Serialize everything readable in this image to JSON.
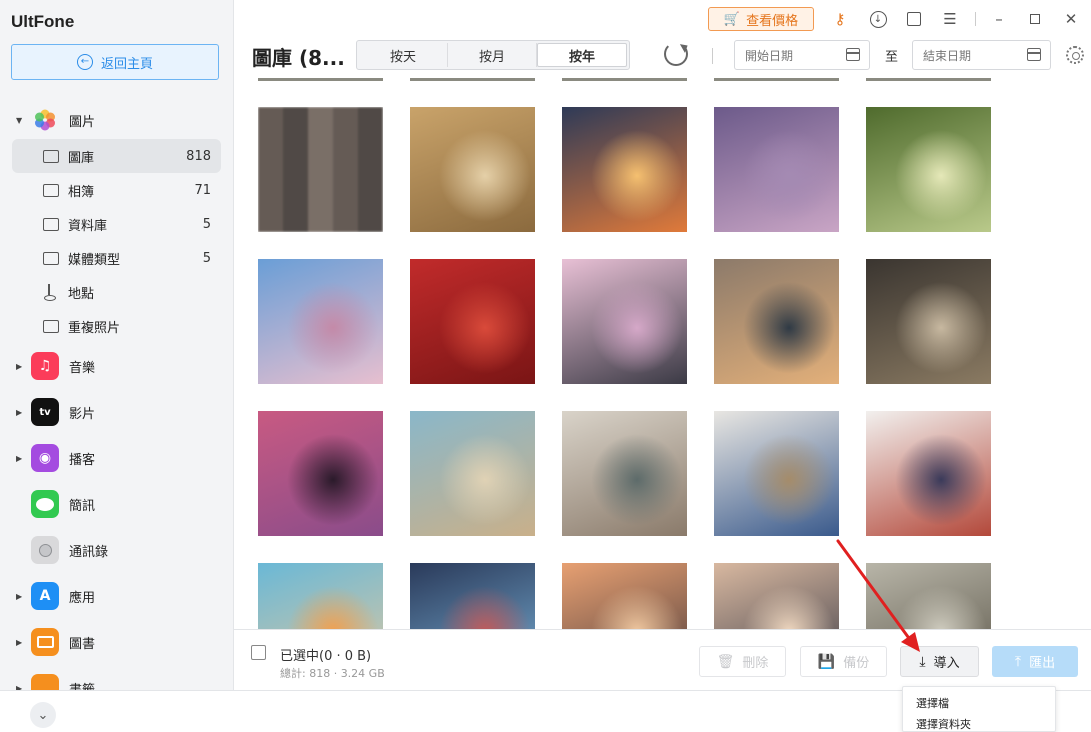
{
  "app": {
    "title": "UltFone"
  },
  "sidebar": {
    "home_button": "返回主頁",
    "photos": {
      "label": "圖片",
      "items": [
        {
          "label": "圖庫",
          "count": "818"
        },
        {
          "label": "相簿",
          "count": "71"
        },
        {
          "label": "資料庫",
          "count": "5"
        },
        {
          "label": "媒體類型",
          "count": "5"
        },
        {
          "label": "地點",
          "count": ""
        },
        {
          "label": "重複照片",
          "count": ""
        }
      ]
    },
    "categories": [
      {
        "label": "音樂",
        "icon": "music-icon",
        "color": "#fb3c5a"
      },
      {
        "label": "影片",
        "icon": "apple-tv-icon",
        "color": "#111111"
      },
      {
        "label": "播客",
        "icon": "podcast-icon",
        "color": "#a44be0"
      },
      {
        "label": "簡訊",
        "icon": "messages-icon",
        "color": "#31c950"
      },
      {
        "label": "通訊錄",
        "icon": "contacts-icon",
        "color": "#9ea0a4"
      },
      {
        "label": "應用",
        "icon": "app-store-icon",
        "color": "#1e8ff5"
      },
      {
        "label": "圖書",
        "icon": "books-icon",
        "color": "#f58f1e"
      }
    ],
    "partial_category": "書籤"
  },
  "titlebar": {
    "price_button": "查看價格",
    "accent": "#e5751c"
  },
  "toolbar": {
    "title": "圖庫 (8...",
    "segments": [
      "按天",
      "按月",
      "按年"
    ],
    "active_segment": "按年",
    "start_date_placeholder": "開始日期",
    "to_label": "至",
    "end_date_placeholder": "結束日期"
  },
  "photos": [
    {
      "desc": "blurred-portrait",
      "colors": [
        "#8a7f78",
        "#5d5550",
        "#b8aca3"
      ]
    },
    {
      "desc": "teddy-bear-costume",
      "colors": [
        "#c9a36a",
        "#8b6a3e",
        "#e5d0a8"
      ]
    },
    {
      "desc": "sunset-clouds",
      "colors": [
        "#2e3a57",
        "#e07a3a",
        "#f5c070"
      ]
    },
    {
      "desc": "dandelion-purple-sky",
      "colors": [
        "#6c5a8a",
        "#c9a5c5",
        "#a48ab3"
      ]
    },
    {
      "desc": "deer-in-forest",
      "colors": [
        "#4f6b2d",
        "#b9c98a",
        "#e5e8b8"
      ]
    },
    {
      "desc": "eiffel-tower-blossoms",
      "colors": [
        "#6a9ed6",
        "#e7bfcf",
        "#c48aa8"
      ]
    },
    {
      "desc": "red-angel-statue",
      "colors": [
        "#c12b2b",
        "#7a1515",
        "#d94a3a"
      ]
    },
    {
      "desc": "palm-tree-pink-sky",
      "colors": [
        "#e8c0d5",
        "#3b3a45",
        "#d5a8c8"
      ]
    },
    {
      "desc": "sunset-lake",
      "colors": [
        "#8c7a6a",
        "#e3b07a",
        "#2f3a45"
      ]
    },
    {
      "desc": "dark-interior-teapot",
      "colors": [
        "#3a3530",
        "#8a7a62",
        "#c7b8a0"
      ]
    },
    {
      "desc": "pink-sunset-trees",
      "colors": [
        "#c85a82",
        "#8a4c8a",
        "#2a1a2a"
      ]
    },
    {
      "desc": "stacked-sculpture-desert",
      "colors": [
        "#8ab7c9",
        "#c9b08a",
        "#e0d2b5"
      ]
    },
    {
      "desc": "venice-canal",
      "colors": [
        "#d9d3c9",
        "#8a7a6a",
        "#5d6b6a"
      ]
    },
    {
      "desc": "person-reading-art-book",
      "colors": [
        "#e8e6e2",
        "#3a5a8c",
        "#a58c6a"
      ]
    },
    {
      "desc": "woman-colorful-sweater",
      "colors": [
        "#f2f0ee",
        "#b3483a",
        "#3a3a5a"
      ]
    },
    {
      "desc": "drinks-on-beach",
      "colors": [
        "#6ab8d6",
        "#e0c8a0",
        "#f0a050"
      ]
    },
    {
      "desc": "nothing-stops-neon",
      "colors": [
        "#2a3a5a",
        "#7ab0d6",
        "#c05a5a"
      ]
    },
    {
      "desc": "palm-sunset-orange",
      "colors": [
        "#e7a072",
        "#4a3a3a",
        "#f0c8a0"
      ]
    },
    {
      "desc": "fence-city-sunset",
      "colors": [
        "#d8b8a0",
        "#3a3a45",
        "#f0d8c0"
      ]
    },
    {
      "desc": "birds-flock",
      "colors": [
        "#b8b5a8",
        "#5a5548",
        "#d0cdc0"
      ]
    }
  ],
  "actionbar": {
    "selected": "已選中(0 · 0 B)",
    "total": "總計: 818 · 3.24 GB",
    "delete": "刪除",
    "backup": "備份",
    "import": "導入",
    "export": "匯出"
  },
  "import_menu": {
    "options": [
      "選擇檔",
      "選擇資料夾"
    ]
  }
}
